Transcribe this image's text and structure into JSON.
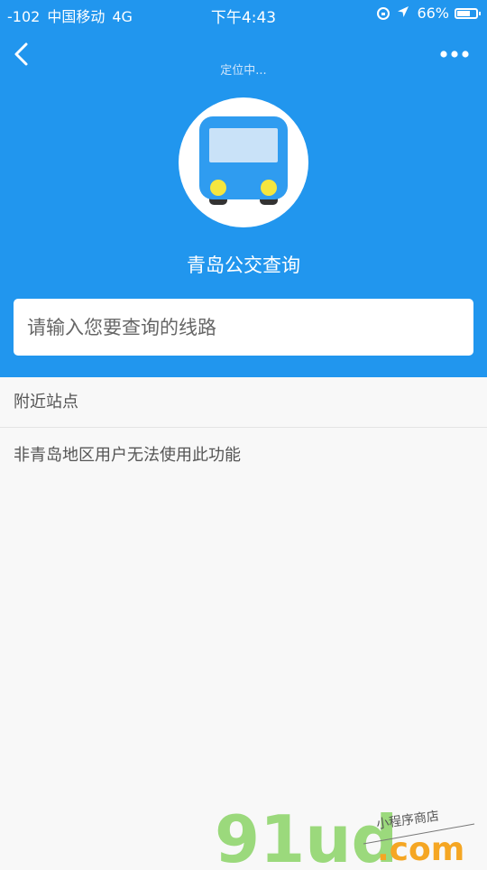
{
  "status_bar": {
    "signal": "-102",
    "carrier": "中国移动",
    "network": "4G",
    "time": "下午4:43",
    "battery": "66%"
  },
  "header": {
    "locating_text": "定位中...",
    "app_title": "青岛公交查询"
  },
  "search": {
    "placeholder": "请输入您要查询的线路"
  },
  "nearby": {
    "section_title": "附近站点",
    "notice": "非青岛地区用户无法使用此功能"
  },
  "watermark": {
    "brand": "91ud",
    "domain": ".com",
    "tagline": "小程序商店"
  },
  "colors": {
    "header_blue": "#2196ee",
    "bus_blue": "#2f9cf0",
    "headlight_yellow": "#f5e63f",
    "watermark_green": "#9bd97c",
    "watermark_orange": "#f5a623"
  }
}
